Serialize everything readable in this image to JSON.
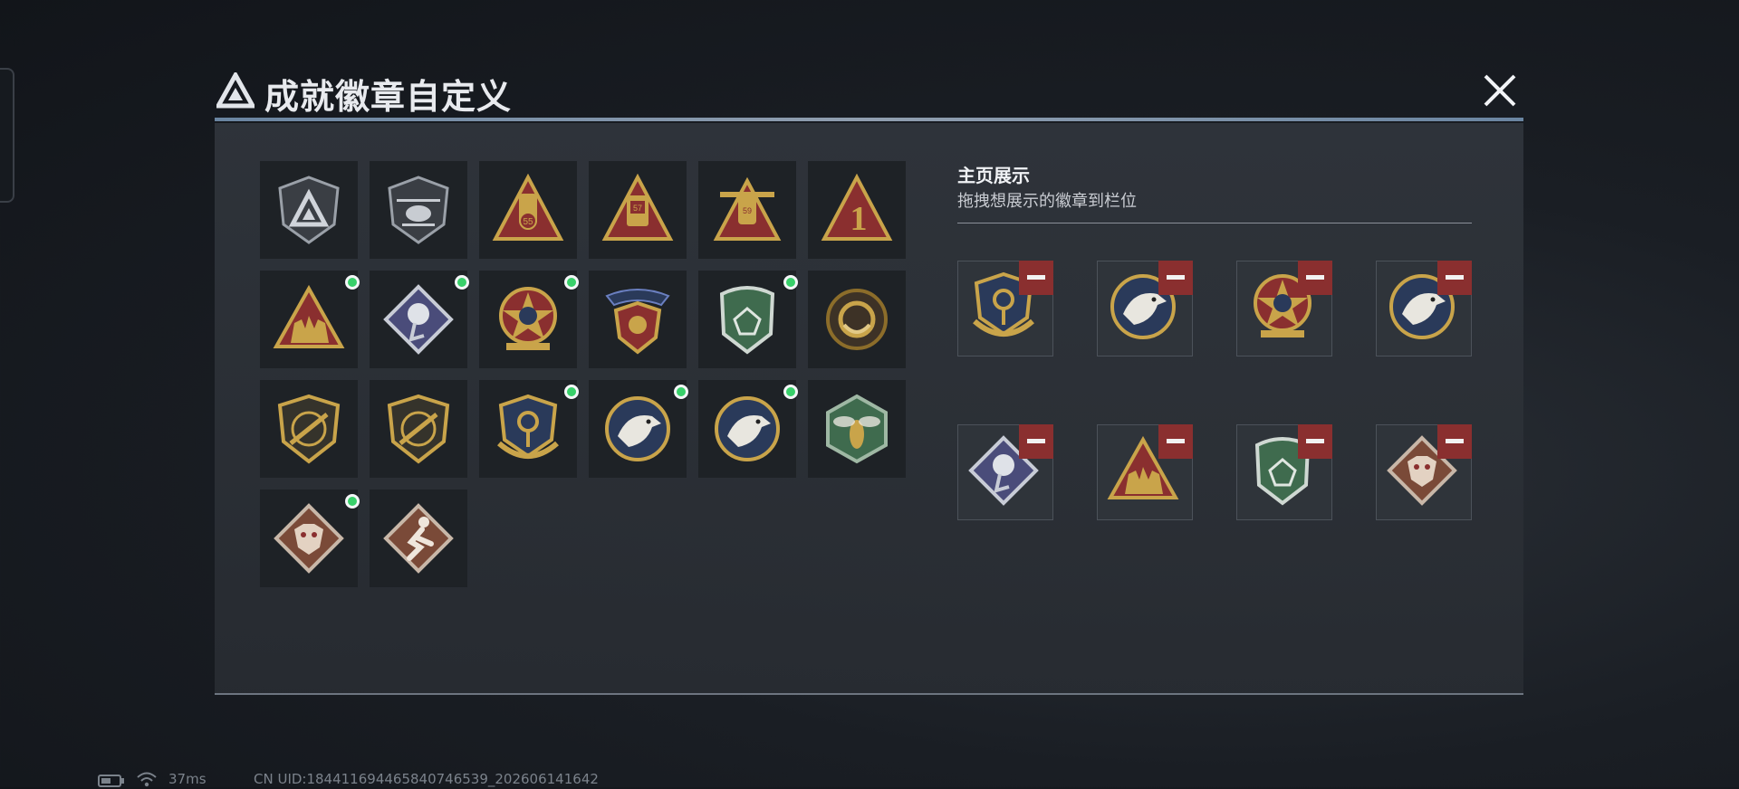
{
  "dialog": {
    "title": "成就徽章自定义",
    "close_icon": "close-x-icon"
  },
  "badges": [
    {
      "icon": "shield-triangle-emblem-icon",
      "new": false
    },
    {
      "icon": "helicopter-shield-icon",
      "new": false
    },
    {
      "icon": "triangle-rank-55-icon",
      "new": false
    },
    {
      "icon": "triangle-rank-57-icon",
      "new": false
    },
    {
      "icon": "triangle-rank-59-star-icon",
      "new": false
    },
    {
      "icon": "triangle-number-1-icon",
      "new": false
    },
    {
      "icon": "triangle-squad-silhouette-icon",
      "new": true
    },
    {
      "icon": "diamond-rose-icon",
      "new": true
    },
    {
      "icon": "star-medal-icon",
      "new": true
    },
    {
      "icon": "winged-shield-crest-icon",
      "new": false
    },
    {
      "icon": "green-gem-shield-icon",
      "new": true
    },
    {
      "icon": "bronze-ring-icon",
      "new": false
    },
    {
      "icon": "rifle-crest-icon",
      "new": false
    },
    {
      "icon": "rifle-crest-icon",
      "new": false
    },
    {
      "icon": "anchor-laurel-shield-icon",
      "new": true
    },
    {
      "icon": "eagle-medallion-icon",
      "new": true
    },
    {
      "icon": "eagle-medallion-icon",
      "new": true
    },
    {
      "icon": "hornet-hexagon-icon",
      "new": false
    },
    {
      "icon": "dragon-diamond-icon",
      "new": true
    },
    {
      "icon": "runner-diamond-icon",
      "new": false
    }
  ],
  "showcase": {
    "title": "主页展示",
    "subtitle": "拖拽想展示的徽章到栏位",
    "slots": [
      {
        "icon": "anchor-laurel-shield-icon"
      },
      {
        "icon": "eagle-medallion-icon"
      },
      {
        "icon": "star-medal-icon"
      },
      {
        "icon": "eagle-medallion-icon"
      },
      {
        "icon": "diamond-rose-icon"
      },
      {
        "icon": "triangle-squad-silhouette-icon"
      },
      {
        "icon": "green-gem-shield-icon"
      },
      {
        "icon": "dragon-diamond-icon"
      }
    ],
    "remove_icon": "minus-icon"
  },
  "status_bar": {
    "ping": "37ms",
    "uid": "CN UID:184411694465840746539_202606141642",
    "battery_icon": "battery-icon",
    "wifi_icon": "wifi-icon"
  },
  "colors": {
    "gold": "#c9a44a",
    "dark_red": "#8a2f2f",
    "navy": "#2a3a5a",
    "green": "#3f6b4e",
    "new_dot": "#38d06a"
  }
}
